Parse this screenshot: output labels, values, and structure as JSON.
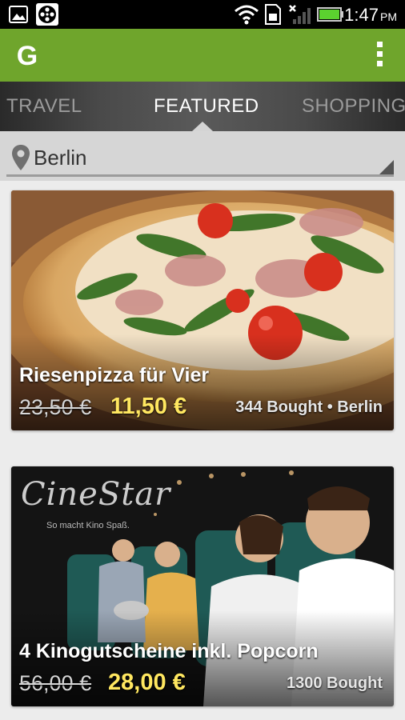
{
  "status_bar": {
    "time": "1:47",
    "ampm": "PM",
    "icons": [
      "gallery-icon",
      "film-reel-icon",
      "wifi-icon",
      "sim-icon",
      "no-signal-icon",
      "battery-icon"
    ]
  },
  "action_bar": {
    "logo_letter": "G",
    "brand_color": "#6fa52c"
  },
  "tabs": [
    {
      "label": "TRAVEL"
    },
    {
      "label": "FEATURED"
    },
    {
      "label": "SHOPPING"
    }
  ],
  "location": {
    "city": "Berlin"
  },
  "deals": [
    {
      "title": "Riesenpizza für Vier",
      "old_price": "23,50 €",
      "new_price": "11,50 €",
      "meta": "344 Bought • Berlin"
    },
    {
      "title": "4 Kinogutscheine inkl. Popcorn",
      "old_price": "56,00 €",
      "new_price": "28,00 €",
      "meta": "1300 Bought",
      "brand_logo": "CineStar",
      "brand_slogan": "So macht Kino Spaß."
    }
  ]
}
